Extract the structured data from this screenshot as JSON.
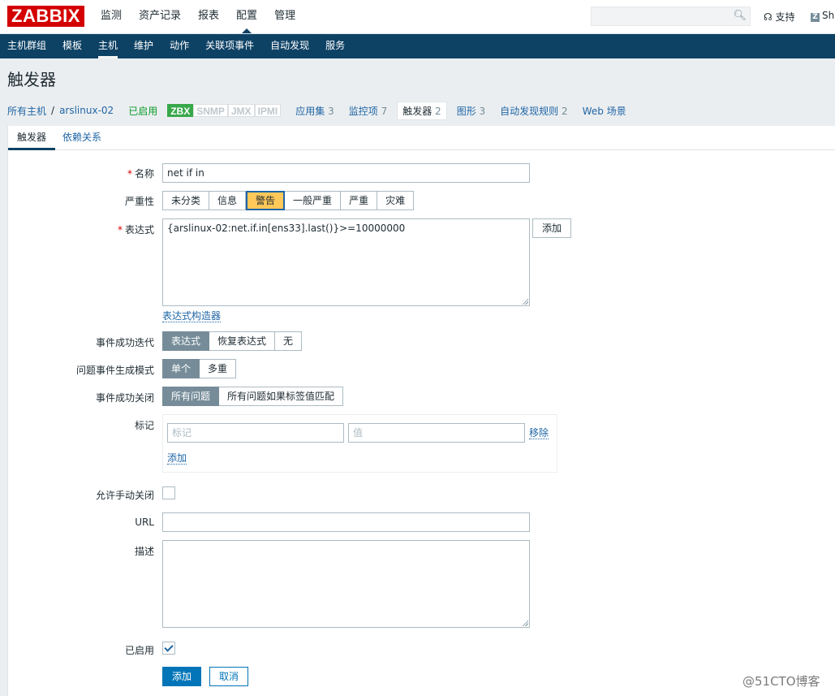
{
  "brand": {
    "logo_text": "ZABBIX"
  },
  "topnav": [
    "监测",
    "资产记录",
    "报表",
    "配置",
    "管理"
  ],
  "topnav_active": "配置",
  "header_right": {
    "search_icon": "search-icon",
    "support": "支持",
    "share": "Sha"
  },
  "subnav": [
    "主机群组",
    "模板",
    "主机",
    "维护",
    "动作",
    "关联项事件",
    "自动发现",
    "服务"
  ],
  "subnav_active": "主机",
  "page": {
    "title": "触发器"
  },
  "hostbar": {
    "all_hosts": "所有主机",
    "separator": "/",
    "host": "arslinux-02",
    "enabled": "已启用",
    "avail": [
      "ZBX",
      "SNMP",
      "JMX",
      "IPMI"
    ],
    "links": [
      {
        "label": "应用集",
        "count": "3"
      },
      {
        "label": "监控项",
        "count": "7"
      },
      {
        "label": "触发器",
        "count": "2"
      },
      {
        "label": "图形",
        "count": "3"
      },
      {
        "label": "自动发现规则",
        "count": "2"
      },
      {
        "label": "Web 场景",
        "count": ""
      }
    ]
  },
  "tabs": [
    "触发器",
    "依赖关系"
  ],
  "form": {
    "name_label": "名称",
    "name_value": "net if in",
    "severity_label": "严重性",
    "severity_options": [
      "未分类",
      "信息",
      "警告",
      "一般严重",
      "严重",
      "灾难"
    ],
    "severity_selected": "警告",
    "expression_label": "表达式",
    "expression_value": "{arslinux-02:net.if.in[ens33].last()}>=10000000",
    "expression_add": "添加",
    "expression_builder": "表达式构造器",
    "ok_event_label": "事件成功迭代",
    "ok_event_options": [
      "表达式",
      "恢复表达式",
      "无"
    ],
    "problem_mode_label": "问题事件生成模式",
    "problem_mode_options": [
      "单个",
      "多重"
    ],
    "ok_close_label": "事件成功关闭",
    "ok_close_options": [
      "所有问题",
      "所有问题如果标签值匹配"
    ],
    "tags_label": "标记",
    "tag_placeholder": "标记",
    "value_placeholder": "值",
    "tag_remove": "移除",
    "tag_add": "添加",
    "manual_close_label": "允许手动关闭",
    "url_label": "URL",
    "desc_label": "描述",
    "enabled_label": "已启用",
    "submit": "添加",
    "cancel": "取消",
    "required_mark": "*"
  },
  "watermark": "@51CTO博客",
  "colors": {
    "brand": "#d40000",
    "nav": "#0e4265",
    "link": "#1f65a6",
    "warning": "#ffc859",
    "primary": "#0275b8",
    "enabled": "#0a9b2c"
  }
}
